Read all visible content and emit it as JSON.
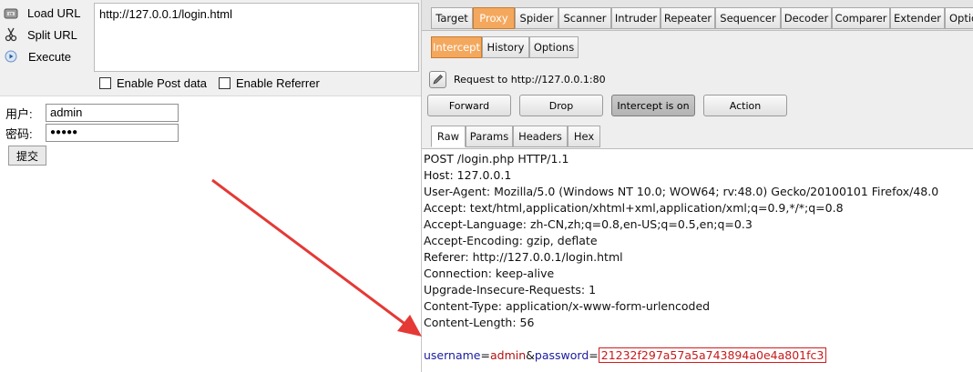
{
  "hackbar": {
    "load_url_label": "Load URL",
    "split_url_label": "Split URL",
    "execute_label": "Execute",
    "url_value": "http://127.0.0.1/login.html",
    "enable_post_label": "Enable Post data",
    "enable_referrer_label": "Enable Referrer"
  },
  "form": {
    "username_label": "用户:",
    "username_value": "admin",
    "password_label": "密码:",
    "password_value": "●●●●●",
    "submit_label": "提交"
  },
  "burp": {
    "main_tabs": [
      "Target",
      "Proxy",
      "Spider",
      "Scanner",
      "Intruder",
      "Repeater",
      "Sequencer",
      "Decoder",
      "Comparer",
      "Extender",
      "Optio"
    ],
    "sub_tabs": [
      "Intercept",
      "History",
      "Options"
    ],
    "request_to": "Request to http://127.0.0.1:80",
    "buttons": {
      "forward": "Forward",
      "drop": "Drop",
      "intercept": "Intercept is on",
      "action": "Action"
    },
    "view_tabs": [
      "Raw",
      "Params",
      "Headers",
      "Hex"
    ],
    "request_headers": [
      "POST /login.php HTTP/1.1",
      "Host: 127.0.0.1",
      "User-Agent: Mozilla/5.0 (Windows NT 10.0; WOW64; rv:48.0) Gecko/20100101 Firefox/48.0",
      "Accept: text/html,application/xhtml+xml,application/xml;q=0.9,*/*;q=0.8",
      "Accept-Language: zh-CN,zh;q=0.8,en-US;q=0.5,en;q=0.3",
      "Accept-Encoding: gzip, deflate",
      "Referer: http://127.0.0.1/login.html",
      "Connection: keep-alive",
      "Upgrade-Insecure-Requests: 1",
      "Content-Type: application/x-www-form-urlencoded",
      "Content-Length: 56"
    ],
    "body": {
      "param1_name": "username",
      "param1_value": "admin",
      "param2_name": "password",
      "param2_value": "21232f297a57a5a743894a0e4a801fc3"
    }
  },
  "colors": {
    "proxy_tab": "#f4a85e",
    "param_name": "#1a1aa0",
    "param_value": "#b01010",
    "highlight_box": "#d21b1b",
    "arrow": "#e53935"
  }
}
